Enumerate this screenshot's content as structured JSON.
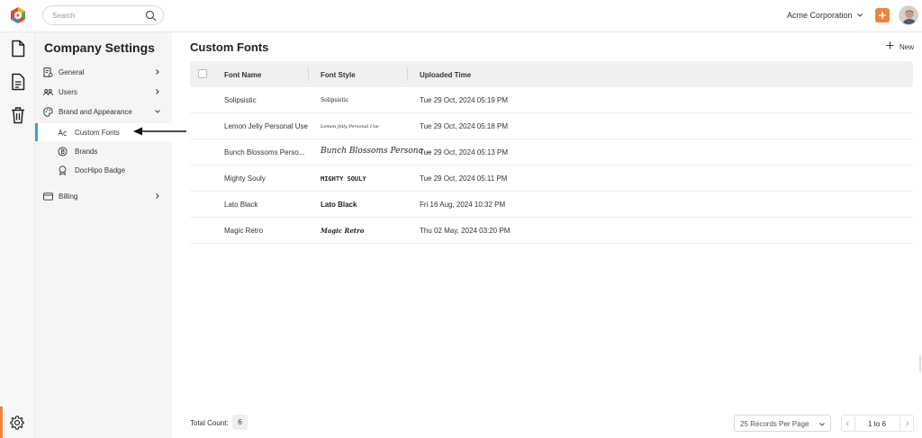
{
  "topbar": {
    "search_placeholder": "Search",
    "organization": "Acme Corporation"
  },
  "sidebar": {
    "title": "Company Settings",
    "items": [
      {
        "label": "General"
      },
      {
        "label": "Users"
      },
      {
        "label": "Brand and Appearance"
      },
      {
        "label": "Billing"
      }
    ],
    "sub_items": [
      {
        "label": "Custom Fonts"
      },
      {
        "label": "Brands"
      },
      {
        "label": "DocHipo Badge"
      }
    ]
  },
  "main": {
    "title": "Custom Fonts",
    "new_label": "New",
    "columns": [
      "Font Name",
      "Font Style",
      "Uploaded Time"
    ],
    "rows": [
      {
        "name": "Solipsistic",
        "style": "Solipsistic",
        "time": "Tue 29 Oct, 2024 05:19 PM"
      },
      {
        "name": "Lemon Jelly Personal Use",
        "style": "Lemon Jelly Personal Use",
        "time": "Tue 29 Oct, 2024 05:18 PM"
      },
      {
        "name": "Bunch Blossoms Perso...",
        "style": "Bunch Blossoms Persona...",
        "time": "Tue 29 Oct, 2024 05:13 PM"
      },
      {
        "name": "Mighty Souly",
        "style": "MIGHTY SOULY",
        "time": "Tue 29 Oct, 2024 05:11 PM"
      },
      {
        "name": "Lato Black",
        "style": "Lato Black",
        "time": "Fri 16 Aug, 2024 10:32 PM"
      },
      {
        "name": "Magic Retro",
        "style": "Magic Retro",
        "time": "Thu 02 May, 2024 03:20 PM"
      }
    ]
  },
  "footer": {
    "total_label": "Total Count:",
    "total_value": "6",
    "per_page": "25 Records Per Page",
    "range": "1 to 6"
  },
  "colors": {
    "accent": "#f0833a",
    "active_indicator": "#2ea2ea"
  }
}
